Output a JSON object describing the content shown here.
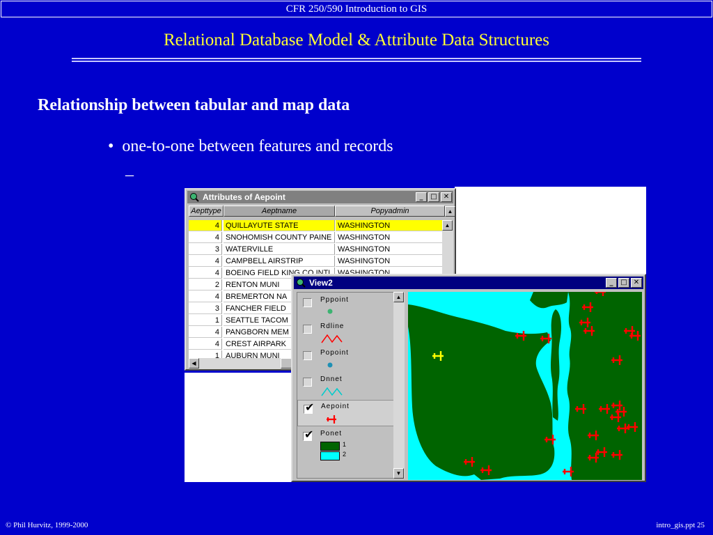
{
  "header": {
    "course": "CFR 250/590 Introduction to GIS"
  },
  "slide": {
    "title": "Relational Database Model & Attribute Data Structures",
    "heading": "Relationship between tabular and map data",
    "bullet": "one-to-one between features and records",
    "subbullet": "–"
  },
  "footer": {
    "left": "© Phil Hurvitz, 1999-2000",
    "right": "intro_gis.ppt  25"
  },
  "attr_window": {
    "title": "Attributes of Aepoint",
    "columns": [
      "Aepttype",
      "Aeptname",
      "Popyadmin"
    ],
    "rows": [
      {
        "type": "4",
        "name": "QUILLAYUTE STATE",
        "admin": "WASHINGTON",
        "selected": true
      },
      {
        "type": "4",
        "name": "SNOHOMISH COUNTY PAINE",
        "admin": "WASHINGTON"
      },
      {
        "type": "3",
        "name": "WATERVILLE",
        "admin": "WASHINGTON"
      },
      {
        "type": "4",
        "name": "CAMPBELL AIRSTRIP",
        "admin": "WASHINGTON"
      },
      {
        "type": "4",
        "name": "BOEING FIELD KING CO INTL",
        "admin": "WASHINGTON"
      },
      {
        "type": "2",
        "name": "RENTON MUNI",
        "admin": ""
      },
      {
        "type": "4",
        "name": "BREMERTON NA",
        "admin": ""
      },
      {
        "type": "3",
        "name": "FANCHER FIELD",
        "admin": ""
      },
      {
        "type": "1",
        "name": "SEATTLE TACOM",
        "admin": ""
      },
      {
        "type": "4",
        "name": "PANGBORN MEM",
        "admin": ""
      },
      {
        "type": "4",
        "name": "CREST AIRPARK",
        "admin": ""
      },
      {
        "type": "1",
        "name": "AUBURN MUNI",
        "admin": ""
      }
    ]
  },
  "view_window": {
    "title": "View2",
    "legend": [
      {
        "label": "Pppoint",
        "checked": false,
        "symbol": "green-dot-icon"
      },
      {
        "label": "Rdline",
        "checked": false,
        "symbol": "red-line-icon"
      },
      {
        "label": "Popoint",
        "checked": false,
        "symbol": "blue-dot-icon"
      },
      {
        "label": "Dnnet",
        "checked": false,
        "symbol": "cyan-line-icon"
      },
      {
        "label": "Aepoint",
        "checked": true,
        "symbol": "airplane-icon"
      },
      {
        "label": "Ponet",
        "checked": true,
        "symbol": "polygon-classes",
        "classes": [
          {
            "value": "1",
            "color": "#006400"
          },
          {
            "value": "2",
            "color": "#00ffff"
          }
        ]
      }
    ]
  },
  "colors": {
    "background": "#0000cc",
    "title": "#ffff33",
    "titlebar": "#000080",
    "land": "#006400",
    "water": "#00ffff",
    "airport": "#ff0000",
    "selected_airport": "#ffff00"
  }
}
